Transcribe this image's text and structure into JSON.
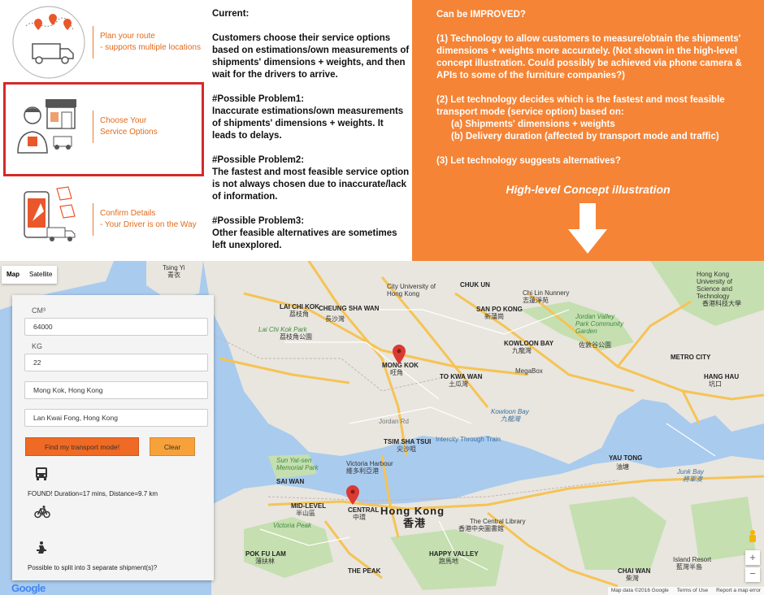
{
  "steps": [
    {
      "line1": "Plan your route",
      "line2": "- supports multiple locations"
    },
    {
      "line1": "Choose Your",
      "line2": "Service Options"
    },
    {
      "line1": "Confirm Details",
      "line2": "- Your Driver is on the Way"
    }
  ],
  "current": {
    "heading": "Current:",
    "para1": "Customers choose their service options based on estimations/own measurements of shipments' dimensions + weights, and then wait for the drivers to arrive.",
    "p1_title": "#Possible Problem1:",
    "p1_text": "Inaccurate estimations/own measurements of shipments' dimensions + weights. It leads to delays.",
    "p2_title": "#Possible Problem2:",
    "p2_text": "The fastest and most feasible service option is not always chosen due to inaccurate/lack of information.",
    "p3_title": "#Possible Problem3:",
    "p3_text": "Other feasible alternatives are sometimes left unexplored."
  },
  "improved": {
    "heading": "Can be IMPROVED?",
    "item1": "(1) Technology to allow customers to measure/obtain the shipments' dimensions + weights more accurately. (Not shown in the high-level concept illustration. Could possibly be achieved via phone camera & APIs to some of the furniture companies?)",
    "item2": "(2) Let technology decides which is the fastest and most feasible transport mode (service option) based on:",
    "item2a": "(a) Shipments' dimensions + weights",
    "item2b": "(b) Delivery duration (affected by transport mode and traffic)",
    "item3": "(3) Let technology suggests alternatives?",
    "concept": "High-level Concept illustration"
  },
  "map": {
    "tab_map": "Map",
    "tab_satellite": "Satellite",
    "labels": {
      "tsing_yi": "Tsing Yi",
      "tsing_yi_cn": "青衣",
      "lai_chi_kok": "LAI CHI KOK",
      "lai_chi_kok_cn": "荔枝角",
      "cheung_sha_wan": "CHEUNG SHA WAN",
      "cheung_sha_wan_cn": "長沙灣",
      "lai_chi_kok_park": "Lai Chi Kok Park",
      "lai_chi_kok_park_cn": "荔枝角公園",
      "city_u": "City University of Hong Kong",
      "chuk_un": "CHUK UN",
      "chi_lin": "Chi Lin Nunnery",
      "chi_lin_cn": "志蓮淨苑",
      "hkust": "Hong Kong University of Science and Technology",
      "hkust_cn": "香港科技大學",
      "jordan_valley": "Jordan Valley Park Community Garden",
      "jordan_valley_cn": "佐敦谷公園",
      "san_po_kong": "SAN PO KONG",
      "san_po_kong_cn": "新蒲崗",
      "kowloon_bay": "KOWLOON BAY",
      "kowloon_bay_cn": "九龍灣",
      "mong_kok": "MONG KOK",
      "mong_kok_cn": "旺角",
      "to_kwa_wan": "TO KWA WAN",
      "to_kwa_wan_cn": "土瓜灣",
      "megabox": "MegaBox",
      "kowloon_bay_water": "Kowloon Bay",
      "kowloon_bay_water_cn": "九龍灣",
      "metro_city": "METRO CITY",
      "hang_hau": "HANG HAU",
      "hang_hau_cn": "坑口",
      "tsim_sha_tsui": "TSIM SHA TSUI",
      "tsim_sha_tsui_cn": "尖沙咀",
      "intercity": "Intercity Through Train",
      "sun_yat_sen": "Sun Yat-sen Memorial Park",
      "victoria_harbour": "Victoria Harbour",
      "victoria_harbour_cn": "維多利亞港",
      "sai_wan": "SAI WAN",
      "mid_level": "MID-LEVEL",
      "mid_level_cn": "半山區",
      "central": "CENTRAL",
      "central_cn": "中環",
      "hong_kong": "Hong Kong",
      "hong_kong_cn": "香港",
      "central_library": "The Central Library",
      "central_library_cn": "香港中央圖書館",
      "victoria_peak": "Victoria Peak",
      "pok_fu_lam": "POK FU LAM",
      "pok_fu_lam_cn": "薄扶林",
      "happy_valley": "HAPPY VALLEY",
      "happy_valley_cn": "跑馬地",
      "the_peak": "THE PEAK",
      "yau_tong": "YAU TONG",
      "yau_tong_cn": "油塘",
      "junk_bay": "Junk Bay",
      "junk_bay_cn": "將軍澳",
      "island_resort": "Island Resort",
      "island_resort_cn": "藍灣半島",
      "chai_wan": "CHAI WAN",
      "chai_wan_cn": "柴灣",
      "jordan_rd": "Jordan Rd"
    },
    "footer_data": "Map data ©2016 Google",
    "footer_terms": "Terms of Use",
    "footer_report": "Report a map error",
    "google": "Google"
  },
  "form": {
    "cm_label": "CM³",
    "cm_value": "64000",
    "kg_label": "KG",
    "kg_value": "22",
    "from": "Mong Kok, Hong Kong",
    "to": "Lan Kwai Fong, Hong Kong",
    "find_label": "Find my transport mode!",
    "clear_label": "Clear",
    "found": "FOUND! Duration=17 mins, Distance=9.7 km",
    "split": "Possible to split into 3 separate shipment(s)?"
  },
  "colors": {
    "orange": "#f58436",
    "accent_text": "#e26a1a",
    "highlight_border": "#d42a2a",
    "find_button": "#ef6a24",
    "clear_button": "#f6a13a",
    "water": "#a9cbee",
    "land": "#e8e6df",
    "road": "#f6c355",
    "park": "#c5dfb0",
    "pin": "#d93a32"
  },
  "icons": [
    "route-planning-illustration",
    "service-options-illustration",
    "driver-phone-illustration",
    "down-arrow-icon",
    "bus-icon",
    "bicycle-icon",
    "walking-icon",
    "map-pin-icon",
    "pegman-icon",
    "zoom-in-icon",
    "zoom-out-icon"
  ]
}
